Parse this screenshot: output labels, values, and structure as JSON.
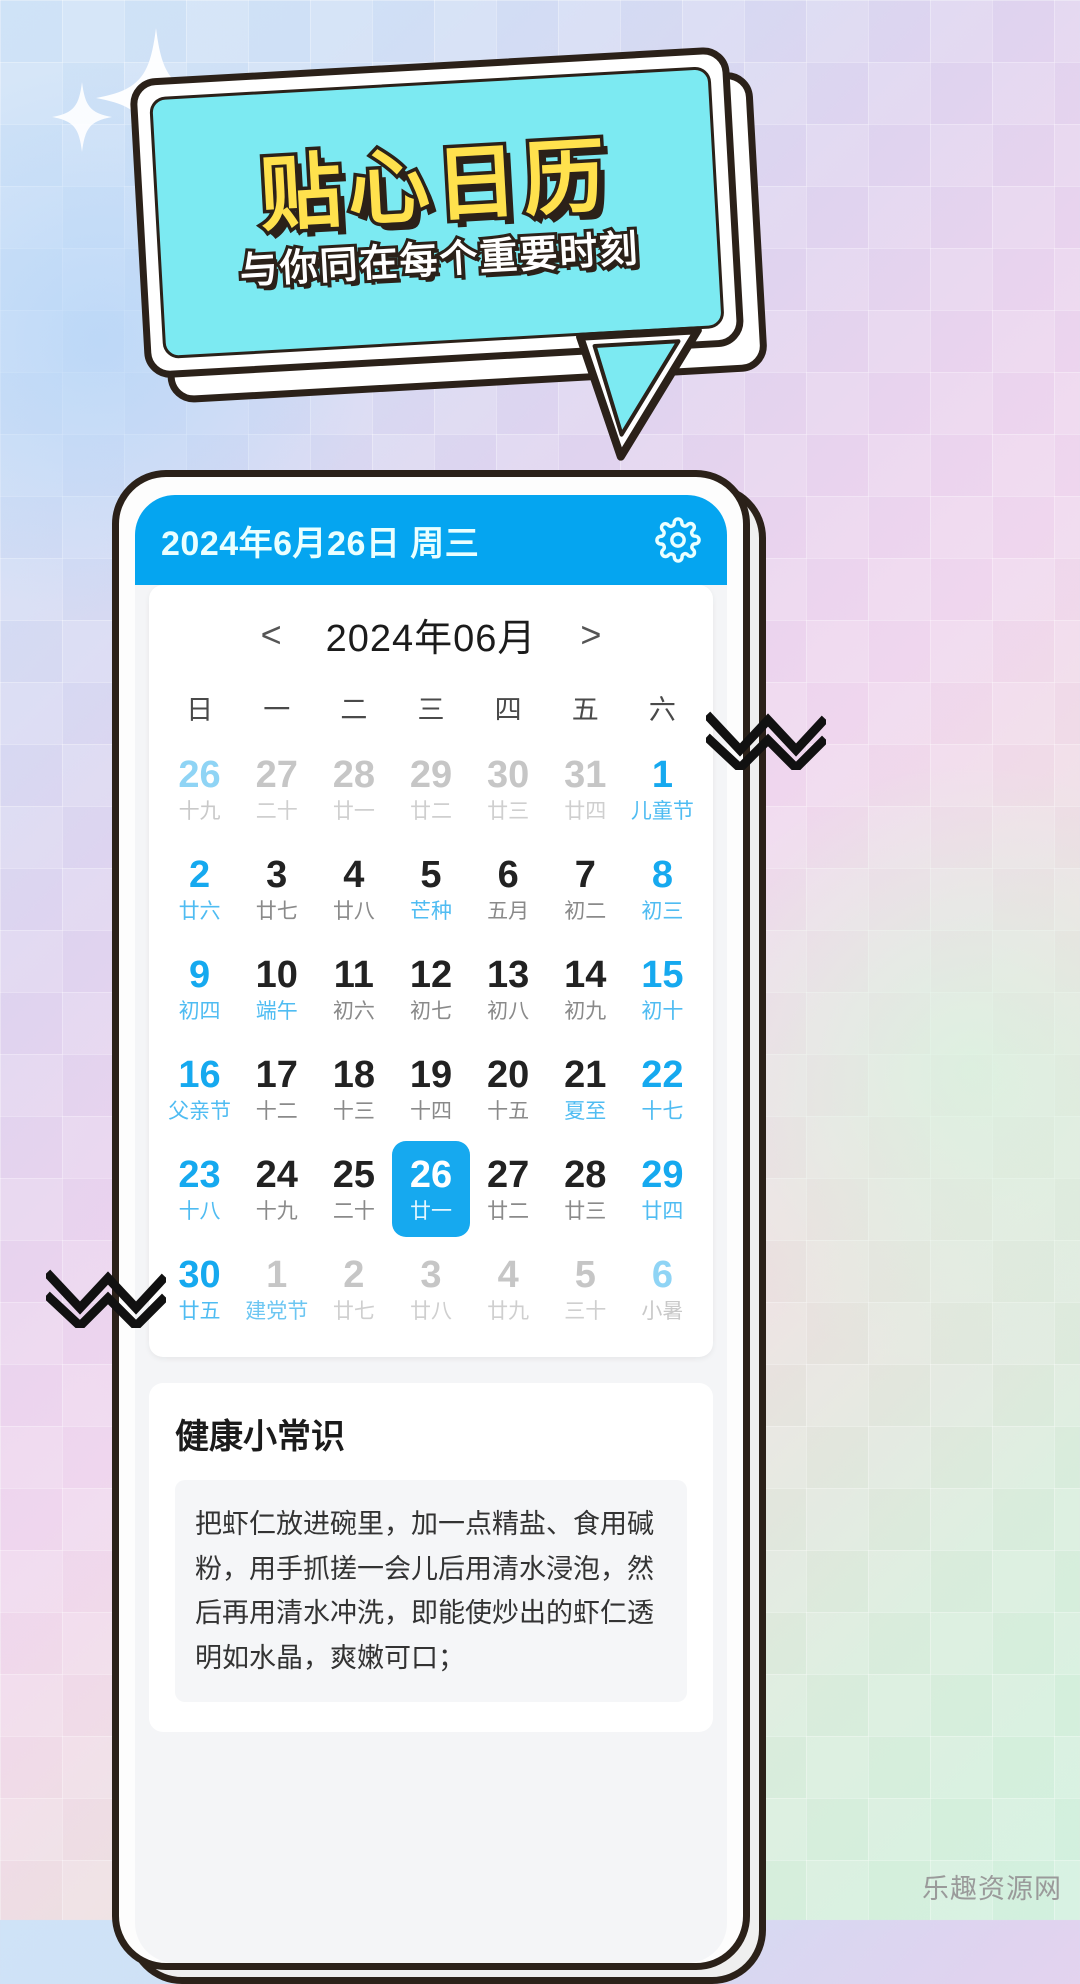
{
  "banner": {
    "title": "贴心日历",
    "subtitle": "与你同在每个重要时刻"
  },
  "phone": {
    "header": {
      "date_text": "2024年6月26日 周三",
      "settings_icon": "gear-icon"
    },
    "calendar": {
      "prev_label": "<",
      "month_label": "2024年06月",
      "next_label": ">",
      "weekdays": [
        "日",
        "一",
        "二",
        "三",
        "四",
        "五",
        "六"
      ],
      "days": [
        {
          "num": "26",
          "lunar": "十九",
          "style": "pale",
          "festival": false,
          "selected": false
        },
        {
          "num": "27",
          "lunar": "二十",
          "style": "gray",
          "festival": false,
          "selected": false
        },
        {
          "num": "28",
          "lunar": "廿一",
          "style": "gray",
          "festival": false,
          "selected": false
        },
        {
          "num": "29",
          "lunar": "廿二",
          "style": "gray",
          "festival": false,
          "selected": false
        },
        {
          "num": "30",
          "lunar": "廿三",
          "style": "gray",
          "festival": false,
          "selected": false
        },
        {
          "num": "31",
          "lunar": "廿四",
          "style": "gray",
          "festival": false,
          "selected": false
        },
        {
          "num": "1",
          "lunar": "儿童节",
          "style": "blue",
          "festival": true,
          "selected": false
        },
        {
          "num": "2",
          "lunar": "廿六",
          "style": "blue",
          "festival": false,
          "selected": false
        },
        {
          "num": "3",
          "lunar": "廿七",
          "style": "dark",
          "festival": false,
          "selected": false
        },
        {
          "num": "4",
          "lunar": "廿八",
          "style": "dark",
          "festival": false,
          "selected": false
        },
        {
          "num": "5",
          "lunar": "芒种",
          "style": "dark",
          "festival": true,
          "selected": false
        },
        {
          "num": "6",
          "lunar": "五月",
          "style": "dark",
          "festival": false,
          "selected": false
        },
        {
          "num": "7",
          "lunar": "初二",
          "style": "dark",
          "festival": false,
          "selected": false
        },
        {
          "num": "8",
          "lunar": "初三",
          "style": "blue",
          "festival": false,
          "selected": false
        },
        {
          "num": "9",
          "lunar": "初四",
          "style": "blue",
          "festival": false,
          "selected": false
        },
        {
          "num": "10",
          "lunar": "端午",
          "style": "dark",
          "festival": true,
          "selected": false
        },
        {
          "num": "11",
          "lunar": "初六",
          "style": "dark",
          "festival": false,
          "selected": false
        },
        {
          "num": "12",
          "lunar": "初七",
          "style": "dark",
          "festival": false,
          "selected": false
        },
        {
          "num": "13",
          "lunar": "初八",
          "style": "dark",
          "festival": false,
          "selected": false
        },
        {
          "num": "14",
          "lunar": "初九",
          "style": "dark",
          "festival": false,
          "selected": false
        },
        {
          "num": "15",
          "lunar": "初十",
          "style": "blue",
          "festival": false,
          "selected": false
        },
        {
          "num": "16",
          "lunar": "父亲节",
          "style": "blue",
          "festival": true,
          "selected": false
        },
        {
          "num": "17",
          "lunar": "十二",
          "style": "dark",
          "festival": false,
          "selected": false
        },
        {
          "num": "18",
          "lunar": "十三",
          "style": "dark",
          "festival": false,
          "selected": false
        },
        {
          "num": "19",
          "lunar": "十四",
          "style": "dark",
          "festival": false,
          "selected": false
        },
        {
          "num": "20",
          "lunar": "十五",
          "style": "dark",
          "festival": false,
          "selected": false
        },
        {
          "num": "21",
          "lunar": "夏至",
          "style": "dark",
          "festival": true,
          "selected": false
        },
        {
          "num": "22",
          "lunar": "十七",
          "style": "blue",
          "festival": false,
          "selected": false
        },
        {
          "num": "23",
          "lunar": "十八",
          "style": "blue",
          "festival": false,
          "selected": false
        },
        {
          "num": "24",
          "lunar": "十九",
          "style": "dark",
          "festival": false,
          "selected": false
        },
        {
          "num": "25",
          "lunar": "二十",
          "style": "dark",
          "festival": false,
          "selected": false
        },
        {
          "num": "26",
          "lunar": "廿一",
          "style": "dark",
          "festival": false,
          "selected": true
        },
        {
          "num": "27",
          "lunar": "廿二",
          "style": "dark",
          "festival": false,
          "selected": false
        },
        {
          "num": "28",
          "lunar": "廿三",
          "style": "dark",
          "festival": false,
          "selected": false
        },
        {
          "num": "29",
          "lunar": "廿四",
          "style": "blue",
          "festival": false,
          "selected": false
        },
        {
          "num": "30",
          "lunar": "廿五",
          "style": "blue",
          "festival": false,
          "selected": false
        },
        {
          "num": "1",
          "lunar": "建党节",
          "style": "gray",
          "festival": true,
          "selected": false
        },
        {
          "num": "2",
          "lunar": "廿七",
          "style": "gray",
          "festival": false,
          "selected": false
        },
        {
          "num": "3",
          "lunar": "廿八",
          "style": "gray",
          "festival": false,
          "selected": false
        },
        {
          "num": "4",
          "lunar": "廿九",
          "style": "gray",
          "festival": false,
          "selected": false
        },
        {
          "num": "5",
          "lunar": "三十",
          "style": "gray",
          "festival": false,
          "selected": false
        },
        {
          "num": "6",
          "lunar": "小暑",
          "style": "pale",
          "festival": true,
          "selected": false
        }
      ]
    },
    "health": {
      "title": "健康小常识",
      "text": "把虾仁放进碗里，加一点精盐、食用碱粉，用手抓搓一会儿后用清水浸泡，然后再用清水冲洗，即能使炒出的虾仁透明如水晶，爽嫩可口；"
    }
  },
  "watermark": "乐趣资源网",
  "colors": {
    "accent_blue": "#05a5f0",
    "date_blue": "#16a9ef",
    "banner_cyan": "#7ceaf2",
    "banner_yellow": "#ffe14d",
    "outline_dark": "#2b2119"
  }
}
